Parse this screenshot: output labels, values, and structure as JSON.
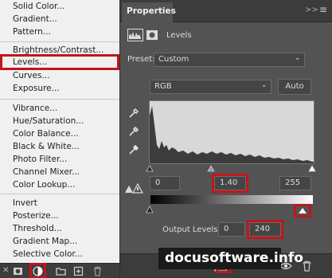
{
  "menu": {
    "items": [
      {
        "label": "Solid Color..."
      },
      {
        "label": "Gradient..."
      },
      {
        "label": "Pattern..."
      },
      {
        "label": "Brightness/Contrast..."
      },
      {
        "label": "Levels..."
      },
      {
        "label": "Curves..."
      },
      {
        "label": "Exposure..."
      },
      {
        "label": "Vibrance..."
      },
      {
        "label": "Hue/Saturation..."
      },
      {
        "label": "Color Balance..."
      },
      {
        "label": "Black & White..."
      },
      {
        "label": "Photo Filter..."
      },
      {
        "label": "Channel Mixer..."
      },
      {
        "label": "Color Lookup..."
      },
      {
        "label": "Invert"
      },
      {
        "label": "Posterize..."
      },
      {
        "label": "Threshold..."
      },
      {
        "label": "Gradient Map..."
      },
      {
        "label": "Selective Color..."
      }
    ],
    "highlighted": "Levels..."
  },
  "panel": {
    "title": "Properties",
    "collapse_glyph": ">>",
    "menu_glyph": "≡",
    "adjustment_label": "Levels",
    "preset_label": "Preset:",
    "preset_value": "Custom",
    "channel_value": "RGB",
    "auto_label": "Auto",
    "input_black": "0",
    "input_midtone": "1.40",
    "input_white": "255",
    "output_label": "Output Levels:",
    "output_black": "0",
    "output_white": "240"
  },
  "watermark": "docusoftware.info",
  "colors": {
    "highlight": "#c0161d",
    "panel_bg": "#535353",
    "menu_bg": "#f0f0f0"
  }
}
